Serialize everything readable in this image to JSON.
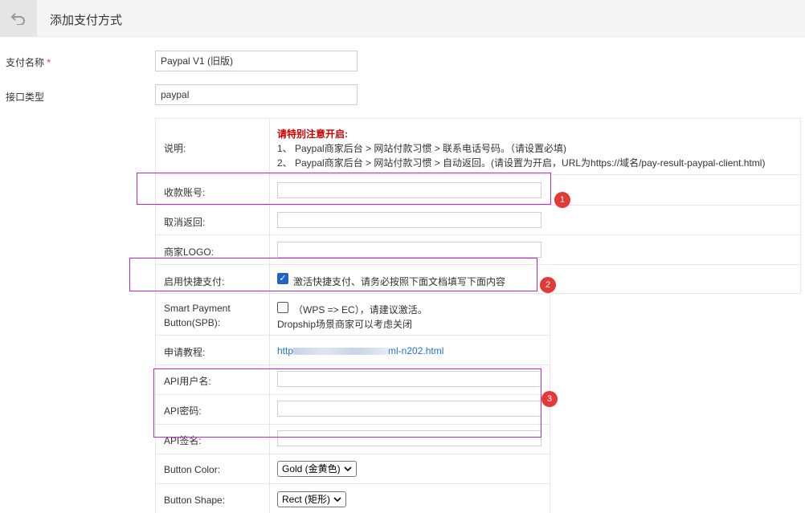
{
  "header": {
    "back_icon": "undo-icon",
    "title": "添加支付方式"
  },
  "form": {
    "payment_name_label": "支付名称",
    "required_mark": "*",
    "payment_name_value": "Paypal V1 (旧版)",
    "interface_type_label": "接口类型",
    "interface_type_value": "paypal"
  },
  "config": {
    "desc_label": "说明:",
    "desc_warning": "请特别注意开启:",
    "desc_line1": "1、 Paypal商家后台 > 网站付款习惯 > 联系电话号码。（请设置必填)",
    "desc_line2": "2、 Paypal商家后台 > 网站付款习惯 > 自动返回。(请设置为开启，URL为https://域名/pay-result-paypal-client.html)",
    "account_label": "收款账号:",
    "cancel_return_label": "取消返回:",
    "logo_label": "商家LOGO:",
    "express_label": "启用快捷支付:",
    "express_text": "激活快捷支付、请务必按照下面文档填写下面内容",
    "spb_label_1": "Smart Payment",
    "spb_label_2": "Button(SPB):",
    "spb_text_1": "（WPS => EC），请建议激活。",
    "spb_text_2": "Dropship场景商家可以考虑关闭",
    "tutorial_label": "申请教程:",
    "tutorial_link_start": "http",
    "tutorial_link_end": "ml-n202.html",
    "api_user_label": "API用户名:",
    "api_pass_label": "API密码:",
    "api_sign_label": "API签名:",
    "button_color_label": "Button Color:",
    "button_color_value": "Gold (金黄色)",
    "button_shape_label": "Button Shape:",
    "button_shape_value": "Rect (矩形)"
  },
  "annotations": {
    "badge1": "1",
    "badge2": "2",
    "badge3": "3",
    "highlight_color": "#c026d3",
    "badge_color": "#e53935"
  },
  "colors": {
    "warning": "#cc0000",
    "link": "#1a73c8",
    "checkbox": "#1e64c8"
  }
}
